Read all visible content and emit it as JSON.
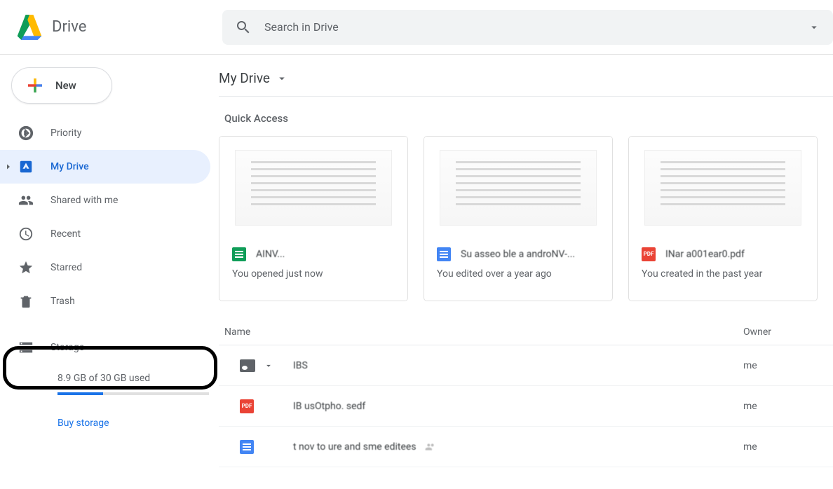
{
  "header": {
    "app_title": "Drive",
    "search_placeholder": "Search in Drive"
  },
  "sidebar": {
    "new_label": "New",
    "items": [
      {
        "label": "Priority"
      },
      {
        "label": "My Drive"
      },
      {
        "label": "Shared with me"
      },
      {
        "label": "Recent"
      },
      {
        "label": "Starred"
      },
      {
        "label": "Trash"
      },
      {
        "label": "Storage"
      }
    ],
    "storage_text": "8.9 GB of 30 GB used",
    "storage_percent": 30,
    "buy_storage_label": "Buy storage"
  },
  "main": {
    "breadcrumb_title": "My Drive",
    "quick_access_label": "Quick Access",
    "quick_access": [
      {
        "title": "AINV...",
        "subtitle": "You opened just now",
        "type": "sheets"
      },
      {
        "title": "Su asseo ble a androNV-...",
        "subtitle": "You edited over a year ago",
        "type": "doc"
      },
      {
        "title": "INar a001ear0.pdf",
        "subtitle": "You created in the past year",
        "type": "pdf"
      }
    ],
    "columns": {
      "name": "Name",
      "owner": "Owner"
    },
    "rows": [
      {
        "title": "IBS",
        "owner": "me",
        "type": "folder"
      },
      {
        "title": "IB usOtpho. sedf",
        "owner": "me",
        "type": "pdf"
      },
      {
        "title": "t nov to   ure and   sme  editees",
        "owner": "me",
        "type": "doc",
        "shared": true
      }
    ]
  }
}
